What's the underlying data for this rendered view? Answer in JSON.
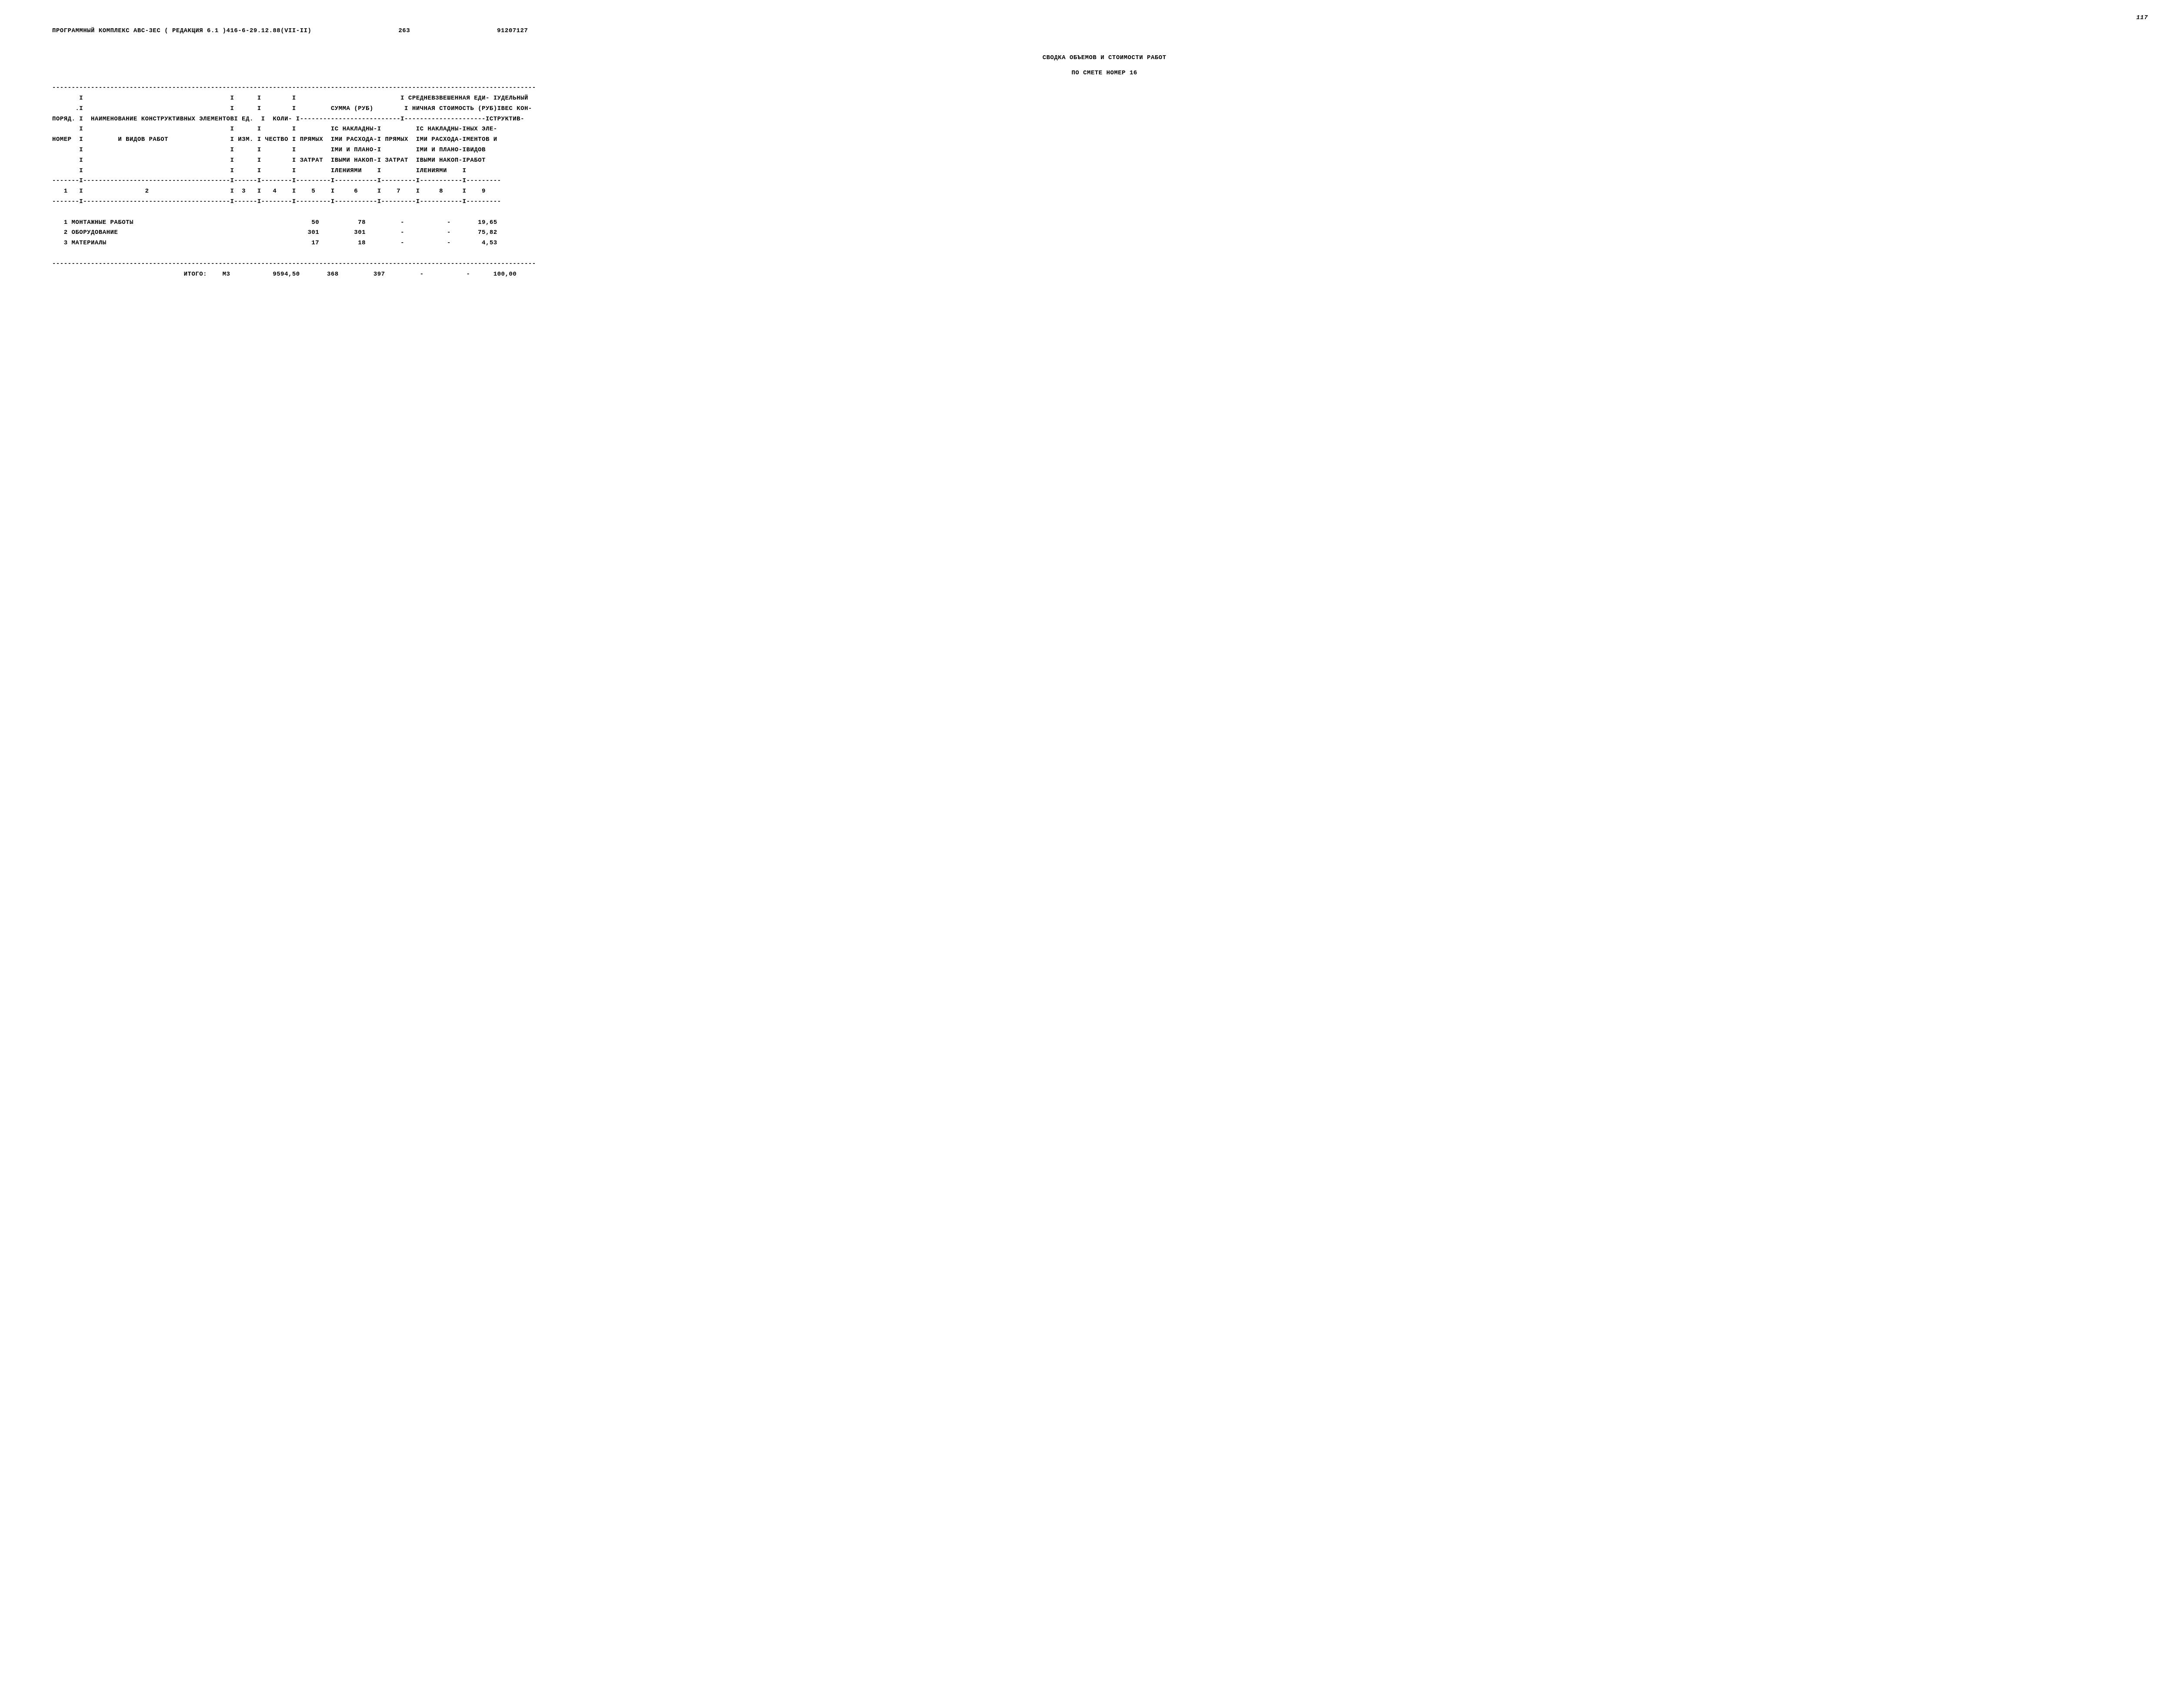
{
  "page_number_handwritten": "117",
  "meta": {
    "program": "ПРОГРАММНЫЙ КОМПЛЕКС АВС-3ЕС  ( РЕДАКЦИЯ  6.1 )416-6-29.12.88(VII-II)",
    "doc_num": "263",
    "code": "91207127"
  },
  "titles": {
    "t1": "СВОДКА ОБЪЕМОВ И СТОИМОСТИ РАБОТ",
    "t2": "ПО СМЕТЕ НОМЕР 16"
  },
  "header_lines": {
    "l1": "-----------------------------------------------------------------------------------------------------------------------------",
    "l2": "       I                                      I      I        I                           I СРЕДНЕВЗВЕШЕННАЯ ЕДИ- IУДЕЛЬНЫЙ",
    "l3": "      .I                                      I      I        I         СУММА (РУБ)        I НИЧНАЯ СТОИМОСТЬ (РУБ)IВЕС КОН-",
    "l4": "ПОРЯД. I  НАИМЕНОВАНИЕ КОНСТРУКТИВНЫХ ЭЛЕМЕНТОВI ЕД.  I  КОЛИ- I--------------------------I---------------------IСТРУКТИВ-",
    "l5": "       I                                      I      I        I         IС НАКЛАДНЫ-I         IС НАКЛАДНЫ-IНЫХ ЭЛЕ-",
    "l6": "НОМЕР  I         И ВИДОВ РАБОТ                I ИЗМ. I ЧЕСТВО I ПРЯМЫХ  IМИ РАСХОДА-I ПРЯМЫХ  IМИ РАСХОДА-IМЕНТОВ И",
    "l7": "       I                                      I      I        I         IМИ И ПЛАНО-I         IМИ И ПЛАНО-IВИДОВ",
    "l8": "       I                                      I      I        I ЗАТРАТ  IВЫМИ НАКОП-I ЗАТРАТ  IВЫМИ НАКОП-IРАБОТ",
    "l9": "       I                                      I      I        I         IЛЕНИЯМИ    I         IЛЕНИЯМИ    I",
    "l10": "-------I--------------------------------------I------I--------I---------I-----------I---------I-----------I---------",
    "l11": "   1   I                2                     I  3   I   4    I    5    I     6     I    7    I     8     I    9",
    "l12": "-------I--------------------------------------I------I--------I---------I-----------I---------I-----------I---------"
  },
  "rows": [
    {
      "num": "1",
      "name": "МОНТАЖНЫЕ РАБОТЫ",
      "unit": "",
      "qty": "",
      "c5": "50",
      "c6": "78",
      "c7": "-",
      "c8": "-",
      "c9": "19,65"
    },
    {
      "num": "2",
      "name": "ОБОРУДОВАНИЕ",
      "unit": "",
      "qty": "",
      "c5": "301",
      "c6": "301",
      "c7": "-",
      "c8": "-",
      "c9": "75,82"
    },
    {
      "num": "3",
      "name": "МАТЕРИАЛЫ",
      "unit": "",
      "qty": "",
      "c5": "17",
      "c6": "18",
      "c7": "-",
      "c8": "-",
      "c9": "4,53"
    }
  ],
  "total": {
    "label": "ИТОГО:",
    "unit": "М3",
    "qty": "9594,50",
    "c5": "368",
    "c6": "397",
    "c7": "-",
    "c8": "-",
    "c9": "100,00"
  },
  "sep": "-----------------------------------------------------------------------------------------------------------------------------",
  "chart_data": {
    "type": "table",
    "title": "СВОДКА ОБЪЕМОВ И СТОИМОСТИ РАБОТ ПО СМЕТЕ НОМЕР 16",
    "columns": [
      "ПОРЯД. НОМЕР",
      "НАИМЕНОВАНИЕ КОНСТРУКТИВНЫХ ЭЛЕМЕНТОВ И ВИДОВ РАБОТ",
      "ЕД. ИЗМ.",
      "КОЛИЧЕСТВО",
      "СУММА (РУБ) ПРЯМЫХ ЗАТРАТ",
      "СУММА (РУБ) С НАКЛАДНЫМИ РАСХОДАМИ И ПЛАНОВЫМИ НАКОПЛЕНИЯМИ",
      "СРЕДНЕВЗВЕШЕННАЯ ЕДИНИЧНАЯ СТОИМОСТЬ (РУБ) ПРЯМЫХ ЗАТРАТ",
      "СРЕДНЕВЗВЕШЕННАЯ ЕДИНИЧНАЯ СТОИМОСТЬ (РУБ) С НАКЛАДНЫМИ РАСХОДАМИ И ПЛАНОВЫМИ НАКОПЛЕНИЯМИ",
      "УДЕЛЬНЫЙ ВЕС КОНСТРУКТИВНЫХ ЭЛЕМЕНТОВ И ВИДОВ РАБОТ"
    ],
    "rows": [
      [
        "1",
        "МОНТАЖНЫЕ РАБОТЫ",
        "",
        "",
        "50",
        "78",
        "-",
        "-",
        "19,65"
      ],
      [
        "2",
        "ОБОРУДОВАНИЕ",
        "",
        "",
        "301",
        "301",
        "-",
        "-",
        "75,82"
      ],
      [
        "3",
        "МАТЕРИАЛЫ",
        "",
        "",
        "17",
        "18",
        "-",
        "-",
        "4,53"
      ]
    ],
    "total_row": [
      "",
      "ИТОГО:",
      "М3",
      "9594,50",
      "368",
      "397",
      "-",
      "-",
      "100,00"
    ]
  }
}
